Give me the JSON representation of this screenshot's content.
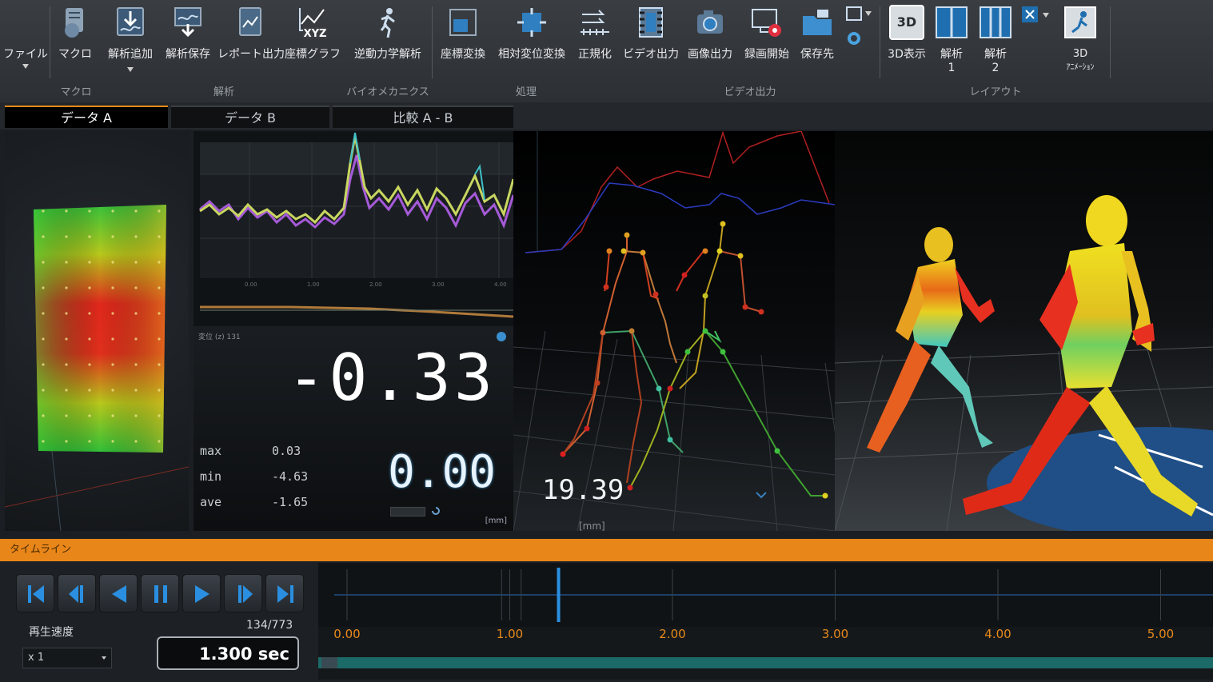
{
  "ribbon": {
    "file": "ファイル",
    "macro": "マクロ",
    "add_analysis": "解析追加",
    "save_analysis": "解析保存",
    "report_output": "レポート出力",
    "coord_graph": "座標グラフ",
    "inverse_dynamics": "逆動力学解析",
    "coord_transform": "座標変換",
    "relative_disp": "相対変位変換",
    "normalize": "正規化",
    "video_output": "ビデオ出力",
    "image_output": "画像出力",
    "start_recording": "録画開始",
    "save_dest": "保存先",
    "view_3d": "3D表示",
    "analysis1": "解析",
    "analysis1_num": "1",
    "analysis2": "解析",
    "analysis2_num": "2",
    "anim_3d": "3D",
    "anim_3d_sub": "ｱﾆﾒｰｼｮﾝ",
    "icon_3d_text": "3D",
    "icon_xyz_text": "XYZ"
  },
  "groups": {
    "macro": "マクロ",
    "analysis": "解析",
    "biomech": "バイオメカニクス",
    "processing": "処理",
    "video": "ビデオ出力",
    "layout": "レイアウト"
  },
  "tabs": [
    "データ A",
    "データ B",
    "比較 A - B"
  ],
  "meter": {
    "header": "変位 (z) 131",
    "value": "-0.33",
    "max_label": "max",
    "max_value": "0.03",
    "min_label": "min",
    "min_value": "-4.63",
    "ave_label": "ave",
    "ave_value": "-1.65",
    "secondary": "0.00",
    "unit": "[mm]",
    "unit_small": "[mm]"
  },
  "skeleton": {
    "readout": "19.39",
    "unit": "[mm]"
  },
  "timeline": {
    "title": "タイムライン",
    "speed_label": "再生速度",
    "speed_value": "x 1",
    "frame": "134/773",
    "time": "1.300 sec",
    "ticks": [
      "0.00",
      "1.00",
      "2.00",
      "3.00",
      "4.00",
      "5.00"
    ],
    "playhead_sec": 1.3,
    "duration_sec": 5.5
  }
}
